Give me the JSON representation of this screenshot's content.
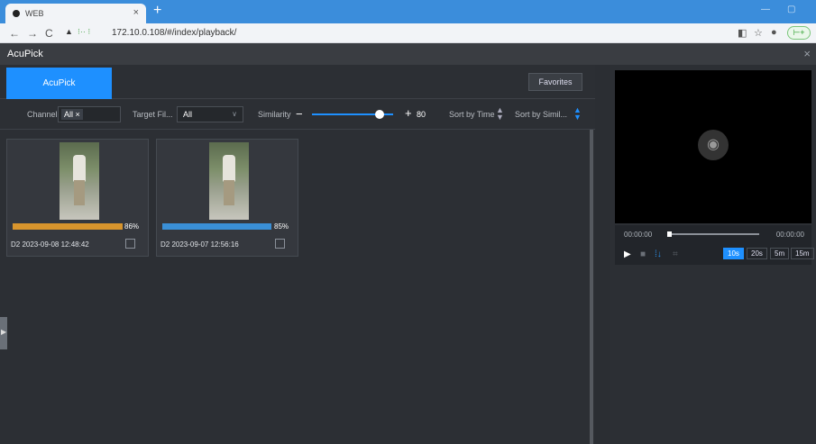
{
  "browser": {
    "tab_title": "WEB",
    "url": "172.10.0.108/#/index/playback/"
  },
  "app": {
    "title": "AcuPick"
  },
  "tabs": {
    "active": "AcuPick",
    "favorites": "Favorites"
  },
  "filters": {
    "channel_label": "Channel",
    "channel_value": "All",
    "target_label": "Target Fil...",
    "target_value": "All",
    "similarity_label": "Similarity",
    "similarity_value": "80",
    "sort_time": "Sort by Time",
    "sort_similarity": "Sort by Simil..."
  },
  "results": [
    {
      "score": "86%",
      "score_value": 86,
      "color": "#d8952d",
      "caption": "D2  2023-09-08 12:48:42"
    },
    {
      "score": "85%",
      "score_value": 85,
      "color": "#3a8fd6",
      "caption": "D2  2023-09-07 12:56:16"
    }
  ],
  "player": {
    "time_start": "00:00:00",
    "time_end": "00:00:00",
    "speeds": [
      "10s",
      "20s",
      "5m",
      "15m"
    ],
    "active_speed": "10s"
  },
  "icons": [
    "camera-icon",
    "play-icon",
    "stop-icon",
    "clip-icon",
    "fullscreen-icon",
    "close-icon"
  ]
}
